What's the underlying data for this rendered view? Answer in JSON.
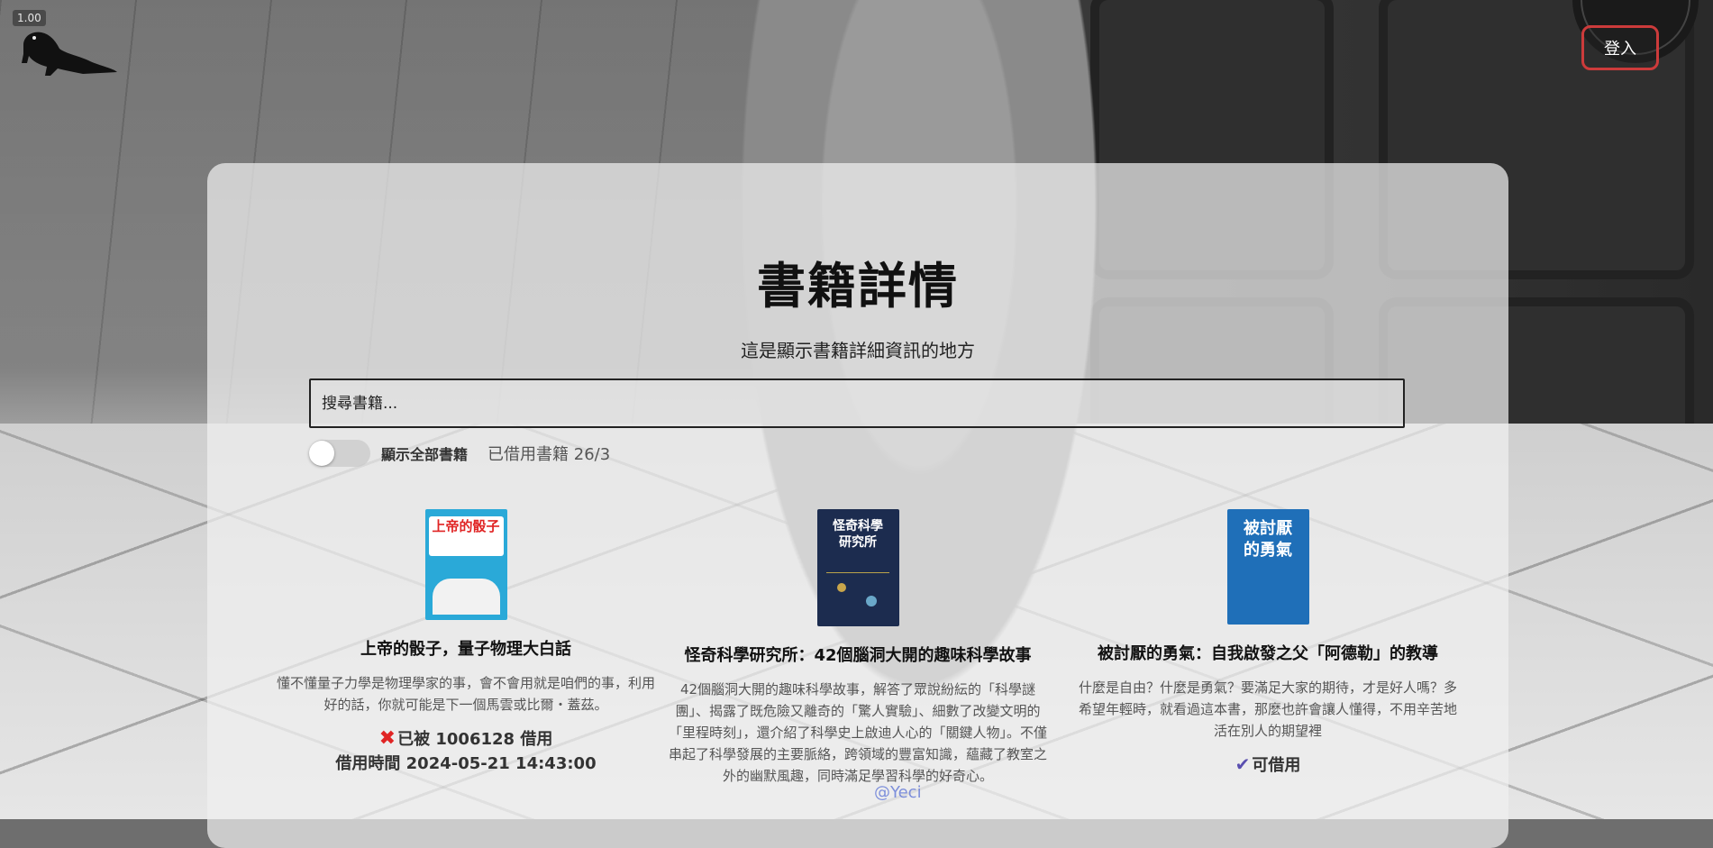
{
  "zoom_badge": "1.00",
  "header": {
    "login_label": "登入"
  },
  "page": {
    "title": "書籍詳情",
    "subtitle": "這是顯示書籍詳細資訊的地方",
    "search_placeholder": "搜尋書籍...",
    "toggle_label": "顯示全部書籍",
    "toggle_on": false,
    "borrowed_count": "已借用書籍 26/3"
  },
  "books": [
    {
      "title": "上帝的骰子，量子物理大白話",
      "description": "懂不懂量子力學是物理學家的事，會不會用就是咱們的事，利用好的話，你就可能是下一個馬雲或比爾・蓋茲。",
      "cover_text": "上帝的骰子",
      "cover_color": "#2aa9d8",
      "status_icon": "x-icon",
      "status_text": "已被 1006128 借用",
      "borrow_time": "借用時間 2024-05-21 14:43:00"
    },
    {
      "title": "怪奇科學研究所：42個腦洞大開的趣味科學故事",
      "description": "42個腦洞大開的趣味科學故事，解答了眾說紛紜的「科學謎團」、揭露了既危險又離奇的「驚人實驗」、細數了改變文明的「里程時刻」，還介紹了科學史上啟迪人心的「關鍵人物」。不僅串起了科學發展的主要脈絡，跨領域的豐富知識，蘊藏了教室之外的幽默風趣，同時滿足學習科學的好奇心。",
      "cover_text": "怪奇科學研究所",
      "cover_color": "#1c2c4f",
      "status_icon": "",
      "status_text": "",
      "borrow_time": ""
    },
    {
      "title": "被討厭的勇氣：自我啟發之父「阿德勒」的教導",
      "description": "什麼是自由？什麼是勇氣？要滿足大家的期待，才是好人嗎？多希望年輕時，就看過這本書，那麼也許會讓人懂得，不用辛苦地活在別人的期望裡",
      "cover_text": "被討厭的勇氣",
      "cover_color": "#1f6fb8",
      "status_icon": "check-icon",
      "status_text": "可借用",
      "borrow_time": ""
    }
  ],
  "watermark": "@Yeci"
}
